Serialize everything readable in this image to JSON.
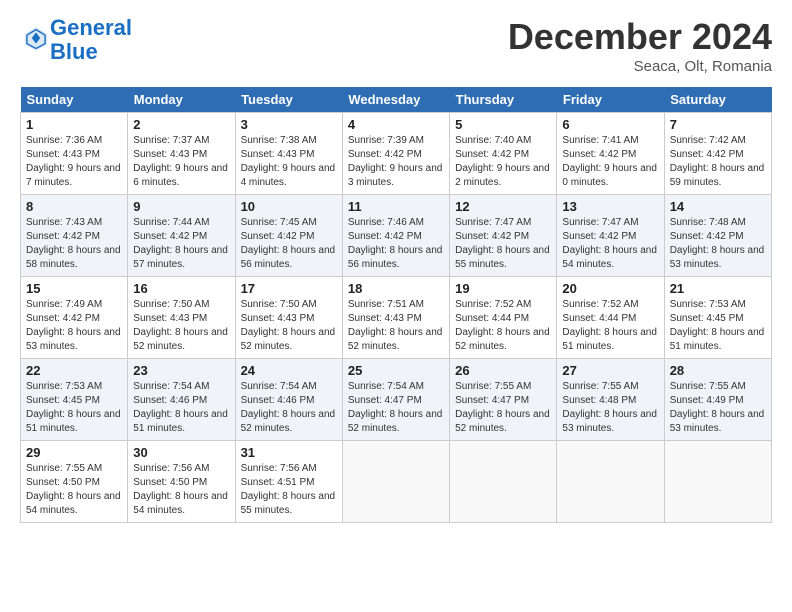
{
  "header": {
    "logo_line1": "General",
    "logo_line2": "Blue",
    "month_title": "December 2024",
    "location": "Seaca, Olt, Romania"
  },
  "days_of_week": [
    "Sunday",
    "Monday",
    "Tuesday",
    "Wednesday",
    "Thursday",
    "Friday",
    "Saturday"
  ],
  "weeks": [
    [
      {
        "day": "1",
        "sunrise": "Sunrise: 7:36 AM",
        "sunset": "Sunset: 4:43 PM",
        "daylight": "Daylight: 9 hours and 7 minutes."
      },
      {
        "day": "2",
        "sunrise": "Sunrise: 7:37 AM",
        "sunset": "Sunset: 4:43 PM",
        "daylight": "Daylight: 9 hours and 6 minutes."
      },
      {
        "day": "3",
        "sunrise": "Sunrise: 7:38 AM",
        "sunset": "Sunset: 4:43 PM",
        "daylight": "Daylight: 9 hours and 4 minutes."
      },
      {
        "day": "4",
        "sunrise": "Sunrise: 7:39 AM",
        "sunset": "Sunset: 4:42 PM",
        "daylight": "Daylight: 9 hours and 3 minutes."
      },
      {
        "day": "5",
        "sunrise": "Sunrise: 7:40 AM",
        "sunset": "Sunset: 4:42 PM",
        "daylight": "Daylight: 9 hours and 2 minutes."
      },
      {
        "day": "6",
        "sunrise": "Sunrise: 7:41 AM",
        "sunset": "Sunset: 4:42 PM",
        "daylight": "Daylight: 9 hours and 0 minutes."
      },
      {
        "day": "7",
        "sunrise": "Sunrise: 7:42 AM",
        "sunset": "Sunset: 4:42 PM",
        "daylight": "Daylight: 8 hours and 59 minutes."
      }
    ],
    [
      {
        "day": "8",
        "sunrise": "Sunrise: 7:43 AM",
        "sunset": "Sunset: 4:42 PM",
        "daylight": "Daylight: 8 hours and 58 minutes."
      },
      {
        "day": "9",
        "sunrise": "Sunrise: 7:44 AM",
        "sunset": "Sunset: 4:42 PM",
        "daylight": "Daylight: 8 hours and 57 minutes."
      },
      {
        "day": "10",
        "sunrise": "Sunrise: 7:45 AM",
        "sunset": "Sunset: 4:42 PM",
        "daylight": "Daylight: 8 hours and 56 minutes."
      },
      {
        "day": "11",
        "sunrise": "Sunrise: 7:46 AM",
        "sunset": "Sunset: 4:42 PM",
        "daylight": "Daylight: 8 hours and 56 minutes."
      },
      {
        "day": "12",
        "sunrise": "Sunrise: 7:47 AM",
        "sunset": "Sunset: 4:42 PM",
        "daylight": "Daylight: 8 hours and 55 minutes."
      },
      {
        "day": "13",
        "sunrise": "Sunrise: 7:47 AM",
        "sunset": "Sunset: 4:42 PM",
        "daylight": "Daylight: 8 hours and 54 minutes."
      },
      {
        "day": "14",
        "sunrise": "Sunrise: 7:48 AM",
        "sunset": "Sunset: 4:42 PM",
        "daylight": "Daylight: 8 hours and 53 minutes."
      }
    ],
    [
      {
        "day": "15",
        "sunrise": "Sunrise: 7:49 AM",
        "sunset": "Sunset: 4:42 PM",
        "daylight": "Daylight: 8 hours and 53 minutes."
      },
      {
        "day": "16",
        "sunrise": "Sunrise: 7:50 AM",
        "sunset": "Sunset: 4:43 PM",
        "daylight": "Daylight: 8 hours and 52 minutes."
      },
      {
        "day": "17",
        "sunrise": "Sunrise: 7:50 AM",
        "sunset": "Sunset: 4:43 PM",
        "daylight": "Daylight: 8 hours and 52 minutes."
      },
      {
        "day": "18",
        "sunrise": "Sunrise: 7:51 AM",
        "sunset": "Sunset: 4:43 PM",
        "daylight": "Daylight: 8 hours and 52 minutes."
      },
      {
        "day": "19",
        "sunrise": "Sunrise: 7:52 AM",
        "sunset": "Sunset: 4:44 PM",
        "daylight": "Daylight: 8 hours and 52 minutes."
      },
      {
        "day": "20",
        "sunrise": "Sunrise: 7:52 AM",
        "sunset": "Sunset: 4:44 PM",
        "daylight": "Daylight: 8 hours and 51 minutes."
      },
      {
        "day": "21",
        "sunrise": "Sunrise: 7:53 AM",
        "sunset": "Sunset: 4:45 PM",
        "daylight": "Daylight: 8 hours and 51 minutes."
      }
    ],
    [
      {
        "day": "22",
        "sunrise": "Sunrise: 7:53 AM",
        "sunset": "Sunset: 4:45 PM",
        "daylight": "Daylight: 8 hours and 51 minutes."
      },
      {
        "day": "23",
        "sunrise": "Sunrise: 7:54 AM",
        "sunset": "Sunset: 4:46 PM",
        "daylight": "Daylight: 8 hours and 51 minutes."
      },
      {
        "day": "24",
        "sunrise": "Sunrise: 7:54 AM",
        "sunset": "Sunset: 4:46 PM",
        "daylight": "Daylight: 8 hours and 52 minutes."
      },
      {
        "day": "25",
        "sunrise": "Sunrise: 7:54 AM",
        "sunset": "Sunset: 4:47 PM",
        "daylight": "Daylight: 8 hours and 52 minutes."
      },
      {
        "day": "26",
        "sunrise": "Sunrise: 7:55 AM",
        "sunset": "Sunset: 4:47 PM",
        "daylight": "Daylight: 8 hours and 52 minutes."
      },
      {
        "day": "27",
        "sunrise": "Sunrise: 7:55 AM",
        "sunset": "Sunset: 4:48 PM",
        "daylight": "Daylight: 8 hours and 53 minutes."
      },
      {
        "day": "28",
        "sunrise": "Sunrise: 7:55 AM",
        "sunset": "Sunset: 4:49 PM",
        "daylight": "Daylight: 8 hours and 53 minutes."
      }
    ],
    [
      {
        "day": "29",
        "sunrise": "Sunrise: 7:55 AM",
        "sunset": "Sunset: 4:50 PM",
        "daylight": "Daylight: 8 hours and 54 minutes."
      },
      {
        "day": "30",
        "sunrise": "Sunrise: 7:56 AM",
        "sunset": "Sunset: 4:50 PM",
        "daylight": "Daylight: 8 hours and 54 minutes."
      },
      {
        "day": "31",
        "sunrise": "Sunrise: 7:56 AM",
        "sunset": "Sunset: 4:51 PM",
        "daylight": "Daylight: 8 hours and 55 minutes."
      },
      null,
      null,
      null,
      null
    ]
  ]
}
